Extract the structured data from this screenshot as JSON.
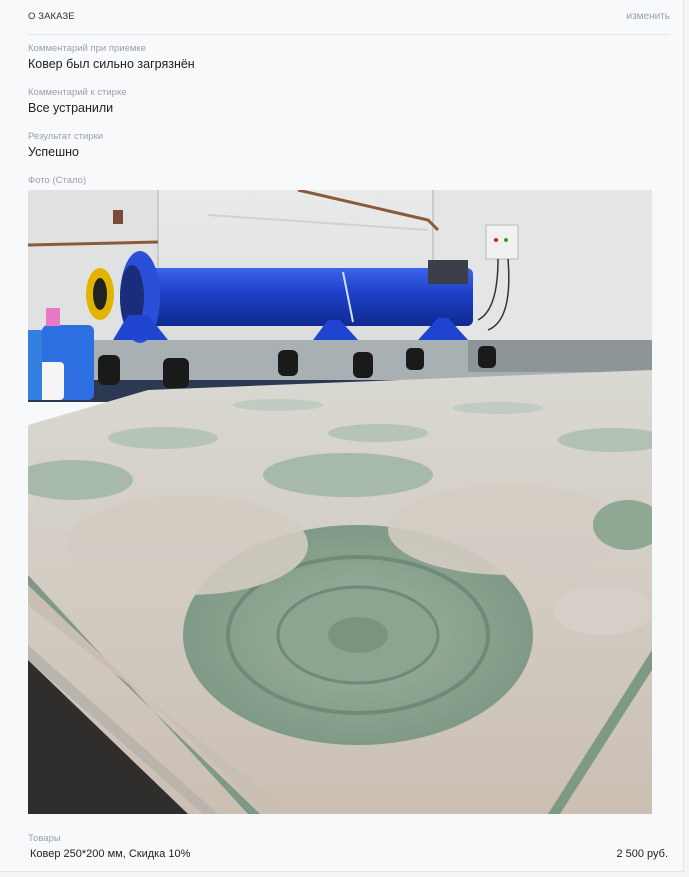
{
  "order": {
    "title": "О ЗАКАЗЕ",
    "edit_label": "изменить"
  },
  "fields": [
    {
      "label": "Комментарий при приемке",
      "value": "Ковер был сильно загрязнён"
    },
    {
      "label": "Комментарий к стирке",
      "value": "Все устранили"
    },
    {
      "label": "Результат стирки",
      "value": "Успешно"
    }
  ],
  "photo": {
    "label": "Фото (Стало)"
  },
  "goods": {
    "label": "Товары",
    "items": [
      {
        "name": "Ковер 250*200 мм, Скидка 10%",
        "price": "2 500 руб."
      }
    ]
  },
  "colors": {
    "accent_blue": "#1a3fc4",
    "carpet_green": "#8fa893"
  }
}
